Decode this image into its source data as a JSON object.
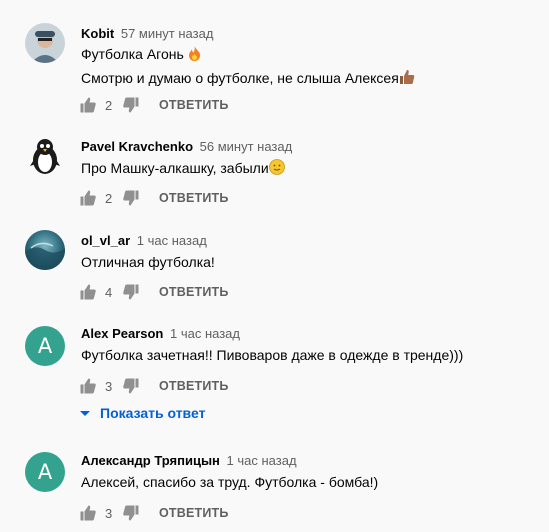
{
  "comments": [
    {
      "author": "Kobit",
      "time": "57 минут назад",
      "lines": [
        "Футболка Агонь ",
        "Смотрю и думаю о футболке, не слыша Алексея"
      ],
      "likes": "2",
      "reply_label": "ОТВЕТИТЬ",
      "avatar_icon": "person-photo-avatar"
    },
    {
      "author": "Pavel Kravchenko",
      "time": "56 минут назад",
      "lines": [
        "Про Машку-алкашку, забыли"
      ],
      "likes": "2",
      "reply_label": "ОТВЕТИТЬ",
      "avatar_icon": "penguin-avatar"
    },
    {
      "author": "ol_vl_ar",
      "time": "1 час назад",
      "lines": [
        "Отличная футболка!"
      ],
      "likes": "4",
      "reply_label": "ОТВЕТИТЬ",
      "avatar_icon": "wave-photo-avatar"
    },
    {
      "author": "Alex Pearson",
      "time": "1 час назад",
      "lines": [
        "Футболка зачетная!! Пивоваров даже в одежде в тренде)))"
      ],
      "likes": "3",
      "reply_label": "ОТВЕТИТЬ",
      "avatar_letter": "A",
      "show_replies": "Показать ответ"
    },
    {
      "author": "Александр Тряпицын",
      "time": "1 час назад",
      "lines": [
        "Алексей, спасибо за труд. Футболка - бомба!)"
      ],
      "likes": "3",
      "reply_label": "ОТВЕТИТЬ",
      "avatar_letter": "A"
    }
  ],
  "colors": {
    "letter_avatar_bg": "#33a38f",
    "link_blue": "#065fd4",
    "meta_gray": "#606060"
  }
}
